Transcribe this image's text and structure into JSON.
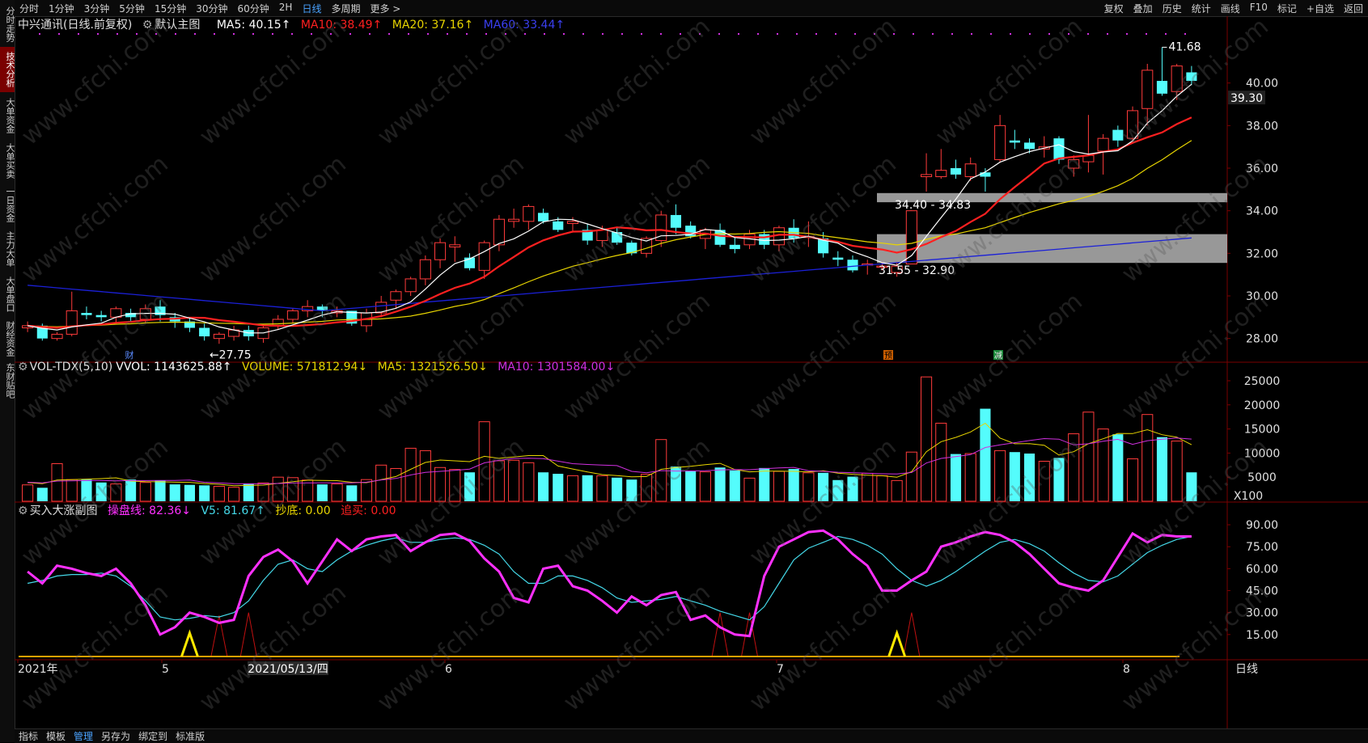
{
  "top_toolbar": {
    "left": [
      "分时",
      "1分钟",
      "3分钟",
      "5分钟",
      "15分钟",
      "30分钟",
      "60分钟",
      "2H",
      "日线",
      "多周期",
      "更多 >"
    ],
    "active": "日线",
    "right": [
      "复权",
      "叠加",
      "历史",
      "统计",
      "画线",
      "F10",
      "标记",
      "+自选",
      "返回"
    ]
  },
  "side_tabs": [
    "分时走势",
    "技术分析",
    "大单资金",
    "大单买卖",
    "一日资金",
    "主力大单",
    "大单盘口",
    "财经资金",
    "东财贴吧"
  ],
  "side_active": "技术分析",
  "main_header": {
    "stock": "中兴通讯(日线.前复权)",
    "chart_mode": "默认主图",
    "ma5": "MA5: 40.15↑",
    "ma10": "MA10: 38.49↑",
    "ma20": "MA20: 37.16↑",
    "ma60": "MA60: 33.44↑"
  },
  "vol_header": {
    "name": "VOL-TDX(5,10)",
    "vvol": "VVOL: 1143625.88↑",
    "volume": "VOLUME: 571812.94↓",
    "ma5": "MA5: 1321526.50↓",
    "ma10": "MA10: 1301584.00↓"
  },
  "ind_header": {
    "name": "买入大涨副图",
    "line1": "操盘线: 82.36↓",
    "v5": "V5: 81.67↑",
    "chaodi": "抄底: 0.00",
    "zhuimai": "追买: 0.00"
  },
  "price_axis": [
    "40.00",
    "38.00",
    "36.00",
    "34.00",
    "32.00",
    "30.00",
    "28.00"
  ],
  "current_price": "39.30",
  "vol_axis": [
    "25000",
    "20000",
    "15000",
    "10000",
    "5000",
    "X100"
  ],
  "ind_axis": [
    "90.00",
    "75.00",
    "60.00",
    "45.00",
    "30.00",
    "15.00"
  ],
  "annotations": {
    "high": "41.68",
    "low": "←27.75",
    "zone_upper": "34.40 - 34.83",
    "zone_lower": "31.55 - 32.90",
    "mark_cai": "财",
    "mark_yu": "预",
    "mark_jian": "减"
  },
  "date_axis": {
    "year": "2021年",
    "m5": "5",
    "cursor_date": "2021/05/13/四",
    "m6": "6",
    "m7": "7",
    "m8": "8"
  },
  "period_label": "日线",
  "bottom_toolbar": [
    "指标",
    "模板",
    "管理",
    "另存为",
    "绑定到",
    "标准版"
  ],
  "bottom_active": "管理",
  "watermark": "www.cfchi.com",
  "colors": {
    "up": "#ff3b3b",
    "down": "#54fcfc",
    "ma5": "#ffffff",
    "ma10": "#ff2020",
    "ma20": "#e8d500",
    "ma60": "#1b20d8",
    "ind_line": "#ff30ff",
    "ind_v5": "#44d8e8"
  },
  "chart_data": {
    "type": "candlestick",
    "price_ylim": [
      27,
      42
    ],
    "candles": [
      [
        28.5,
        28.8,
        28.3,
        28.6
      ],
      [
        28.6,
        28.7,
        27.9,
        28.0
      ],
      [
        28.0,
        28.3,
        27.9,
        28.2
      ],
      [
        28.2,
        30.2,
        28.1,
        29.3
      ],
      [
        29.2,
        29.5,
        28.9,
        29.1
      ],
      [
        29.1,
        29.3,
        28.8,
        29.0
      ],
      [
        29.0,
        29.5,
        28.7,
        29.4
      ],
      [
        29.2,
        29.4,
        28.8,
        29.0
      ],
      [
        28.9,
        29.6,
        28.7,
        29.4
      ],
      [
        29.5,
        29.8,
        28.8,
        29.1
      ],
      [
        29.0,
        29.2,
        28.5,
        28.8
      ],
      [
        28.8,
        29.0,
        28.3,
        28.5
      ],
      [
        28.5,
        28.7,
        27.9,
        28.1
      ],
      [
        28.0,
        28.3,
        27.75,
        28.2
      ],
      [
        28.1,
        28.6,
        27.9,
        28.4
      ],
      [
        28.4,
        28.6,
        27.9,
        28.1
      ],
      [
        28.0,
        28.6,
        27.8,
        28.5
      ],
      [
        28.6,
        29.1,
        28.4,
        28.9
      ],
      [
        28.9,
        29.4,
        28.7,
        29.3
      ],
      [
        29.3,
        29.8,
        29.0,
        29.5
      ],
      [
        29.5,
        29.6,
        29.0,
        29.3
      ],
      [
        29.2,
        29.5,
        29.0,
        29.3
      ],
      [
        29.3,
        29.3,
        28.6,
        28.7
      ],
      [
        28.6,
        29.4,
        28.3,
        29.2
      ],
      [
        29.2,
        30.0,
        29.0,
        29.7
      ],
      [
        29.8,
        30.3,
        29.4,
        30.2
      ],
      [
        30.2,
        30.9,
        30.0,
        30.8
      ],
      [
        30.8,
        31.9,
        30.5,
        31.7
      ],
      [
        31.7,
        32.7,
        31.3,
        32.5
      ],
      [
        32.3,
        32.8,
        31.6,
        32.4
      ],
      [
        31.8,
        32.0,
        31.2,
        31.3
      ],
      [
        31.2,
        32.6,
        30.8,
        32.5
      ],
      [
        32.4,
        33.8,
        32.1,
        33.6
      ],
      [
        33.5,
        34.1,
        33.2,
        33.6
      ],
      [
        33.5,
        34.3,
        33.1,
        34.2
      ],
      [
        33.9,
        34.1,
        33.4,
        33.5
      ],
      [
        33.5,
        33.7,
        33.0,
        33.1
      ],
      [
        33.4,
        33.7,
        33.0,
        33.5
      ],
      [
        33.1,
        33.4,
        32.4,
        32.6
      ],
      [
        32.6,
        33.3,
        32.3,
        33.1
      ],
      [
        33.0,
        33.2,
        32.4,
        32.5
      ],
      [
        32.5,
        32.6,
        31.9,
        32.0
      ],
      [
        32.0,
        32.8,
        31.8,
        32.7
      ],
      [
        32.6,
        34.0,
        32.3,
        33.8
      ],
      [
        33.8,
        34.3,
        32.9,
        33.2
      ],
      [
        33.3,
        33.5,
        32.7,
        32.8
      ],
      [
        32.7,
        33.2,
        32.2,
        33.1
      ],
      [
        33.1,
        33.4,
        32.3,
        32.4
      ],
      [
        32.4,
        32.8,
        32.0,
        32.2
      ],
      [
        32.4,
        33.1,
        32.2,
        32.9
      ],
      [
        32.9,
        33.1,
        32.2,
        32.4
      ],
      [
        32.4,
        33.3,
        32.1,
        33.2
      ],
      [
        33.2,
        33.6,
        32.5,
        32.7
      ],
      [
        32.8,
        33.5,
        32.3,
        32.8
      ],
      [
        32.7,
        33.0,
        31.8,
        32.0
      ],
      [
        31.8,
        32.1,
        31.4,
        31.7
      ],
      [
        31.7,
        31.9,
        31.1,
        31.2
      ],
      [
        31.5,
        31.7,
        31.0,
        31.5
      ],
      [
        31.4,
        31.6,
        31.2,
        31.4
      ],
      [
        31.1,
        31.6,
        30.9,
        31.4
      ],
      [
        31.5,
        34.0,
        31.5,
        34.0
      ],
      [
        35.6,
        36.7,
        34.9,
        35.7
      ],
      [
        35.6,
        36.9,
        35.5,
        35.9
      ],
      [
        36.0,
        36.4,
        35.5,
        35.7
      ],
      [
        35.6,
        36.5,
        35.4,
        36.2
      ],
      [
        35.8,
        36.0,
        34.9,
        35.6
      ],
      [
        36.4,
        38.5,
        36.3,
        38.0
      ],
      [
        37.3,
        37.8,
        36.9,
        37.2
      ],
      [
        37.2,
        37.4,
        36.7,
        36.9
      ],
      [
        36.9,
        37.5,
        36.5,
        37.0
      ],
      [
        37.4,
        37.5,
        36.2,
        36.4
      ],
      [
        36.0,
        36.6,
        35.6,
        36.4
      ],
      [
        36.3,
        38.5,
        35.8,
        36.6
      ],
      [
        36.8,
        37.6,
        35.7,
        37.4
      ],
      [
        37.8,
        38.0,
        37.0,
        37.3
      ],
      [
        37.4,
        38.9,
        37.2,
        38.7
      ],
      [
        38.8,
        40.9,
        38.0,
        40.6
      ],
      [
        40.1,
        41.68,
        39.4,
        39.5
      ],
      [
        39.6,
        40.9,
        39.2,
        40.8
      ],
      [
        40.5,
        40.8,
        39.9,
        40.1
      ]
    ],
    "volume_ylim": [
      0,
      26000
    ],
    "volume": [
      3400,
      2800,
      7800,
      4500,
      4500,
      3900,
      3600,
      4500,
      3900,
      4300,
      3500,
      3400,
      3300,
      3100,
      2900,
      3700,
      3800,
      5000,
      4900,
      4400,
      3500,
      3600,
      3300,
      4500,
      7500,
      6800,
      11000,
      10500,
      7000,
      6600,
      6000,
      16500,
      8400,
      8500,
      8000,
      6000,
      5700,
      5300,
      5400,
      5300,
      4900,
      4500,
      5600,
      12800,
      7200,
      6200,
      6100,
      7000,
      6400,
      4800,
      6900,
      6200,
      6700,
      5900,
      5900,
      4400,
      5100,
      5800,
      5300,
      4300,
      10200,
      25800,
      16200,
      9800,
      9900,
      19200,
      10500,
      10200,
      9900,
      8300,
      9000,
      14000,
      18500,
      15000,
      13900,
      8800,
      18000,
      13300,
      12500,
      6000
    ],
    "ind_ylim": [
      0,
      95
    ],
    "ind_line": [
      58,
      50,
      62,
      60,
      57,
      55,
      60,
      50,
      35,
      15,
      20,
      30,
      27,
      23,
      25,
      55,
      68,
      73,
      65,
      50,
      65,
      80,
      72,
      80,
      82,
      83,
      72,
      78,
      83,
      84,
      79,
      67,
      58,
      40,
      37,
      60,
      62,
      48,
      45,
      38,
      30,
      41,
      35,
      42,
      44,
      25,
      28,
      20,
      15,
      14,
      55,
      75,
      80,
      85,
      86,
      80,
      70,
      62,
      45,
      45,
      52,
      58,
      75,
      78,
      82,
      85,
      83,
      78,
      70,
      60,
      50,
      47,
      45,
      52,
      68,
      84,
      78,
      83,
      82,
      82
    ],
    "ind_v5": [
      50,
      52,
      55,
      56,
      56,
      57,
      55,
      48,
      38,
      27,
      25,
      26,
      28,
      27,
      30,
      38,
      52,
      63,
      66,
      60,
      58,
      66,
      72,
      76,
      79,
      81,
      78,
      78,
      80,
      81,
      80,
      76,
      70,
      58,
      50,
      50,
      55,
      55,
      52,
      47,
      40,
      37,
      38,
      39,
      41,
      38,
      35,
      31,
      28,
      25,
      34,
      50,
      66,
      74,
      78,
      82,
      80,
      76,
      70,
      60,
      52,
      48,
      52,
      58,
      65,
      72,
      78,
      80,
      77,
      72,
      64,
      57,
      52,
      51,
      55,
      63,
      71,
      76,
      80,
      82
    ]
  }
}
